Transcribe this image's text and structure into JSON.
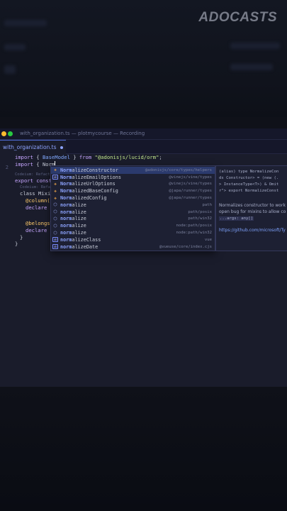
{
  "brand": "ADOCASTS",
  "window": {
    "title": "with_organization.ts — plotmycourse — Recording",
    "active_tab": "with_organization.ts"
  },
  "code": {
    "line1": {
      "kw": "import",
      "open": " { ",
      "id": "BaseModel",
      "close": " } ",
      "from": "from",
      "str": "\"@adonisjs/lucid/orm\"",
      "semi": ";"
    },
    "line2": {
      "kw": "import",
      "typed": " { Norm"
    },
    "gutter_2": "2",
    "hint1": "Codeium: Refactor | Explain",
    "line_export": "export const",
    "hint2": "Codeium: Refactor | Explain",
    "line_class": "class Mixin",
    "line_column": "@column()",
    "line_declare1": "declare o",
    "line_belongs": "@belongsT",
    "line_declare2": "declare o",
    "line_close1": "}",
    "line_close2": "}"
  },
  "suggestions": [
    {
      "bold": "Norm",
      "rest": "alizeConstructor",
      "detail": "@adonisjs/core/types/helpers",
      "icon": "cls",
      "selected": true
    },
    {
      "bold": "Norm",
      "rest": "alizeEmailOptions",
      "detail": "@vinejs/vine/types",
      "icon": "var",
      "selected": false
    },
    {
      "bold": "Norm",
      "rest": "alizeUrlOptions",
      "detail": "@vinejs/vine/types",
      "icon": "cls",
      "selected": false
    },
    {
      "bold": "Norm",
      "rest": "alizedBaseConfig",
      "detail": "@japa/runner/types",
      "icon": "cls",
      "selected": false
    },
    {
      "bold": "Norm",
      "rest": "alizedConfig",
      "detail": "@japa/runner/types",
      "icon": "cls",
      "selected": false
    },
    {
      "bold": "norm",
      "rest": "alize",
      "detail": "path",
      "icon": "fn",
      "selected": false
    },
    {
      "bold": "norm",
      "rest": "alize",
      "detail": "path/posix",
      "icon": "fn",
      "selected": false
    },
    {
      "bold": "norm",
      "rest": "alize",
      "detail": "path/win32",
      "icon": "fn",
      "selected": false
    },
    {
      "bold": "norm",
      "rest": "alize",
      "detail": "node:path/posix",
      "icon": "fn",
      "selected": false
    },
    {
      "bold": "norm",
      "rest": "alize",
      "detail": "node:path/win32",
      "icon": "fn",
      "selected": false
    },
    {
      "bold": "norm",
      "rest": "alizeClass",
      "detail": "vue",
      "icon": "var",
      "selected": false
    },
    {
      "bold": "norm",
      "rest": "alizeDate",
      "detail": "@vueuse/core/index.cjs",
      "icon": "var",
      "selected": false
    }
  ],
  "docs": {
    "l1": "(alias) type NormalizeCon",
    "l2": "ds Constructor> = (new (.",
    "l3": "> InstanceType<T>) & Omit",
    "l4": "r\"> export NormalizeConst",
    "p1": "Normalizes constructor to work",
    "p2": "open bug for mixins to allow co",
    "p3": "...args: any[]",
    "link": "https://github.com/microsoft/Ty"
  },
  "colors": {
    "accent": "#8ea4ff",
    "selected_row": "#2b3a6d",
    "close_dot": "#ff5f57",
    "min_dot": "#febc2e",
    "max_dot": "#28c840"
  }
}
